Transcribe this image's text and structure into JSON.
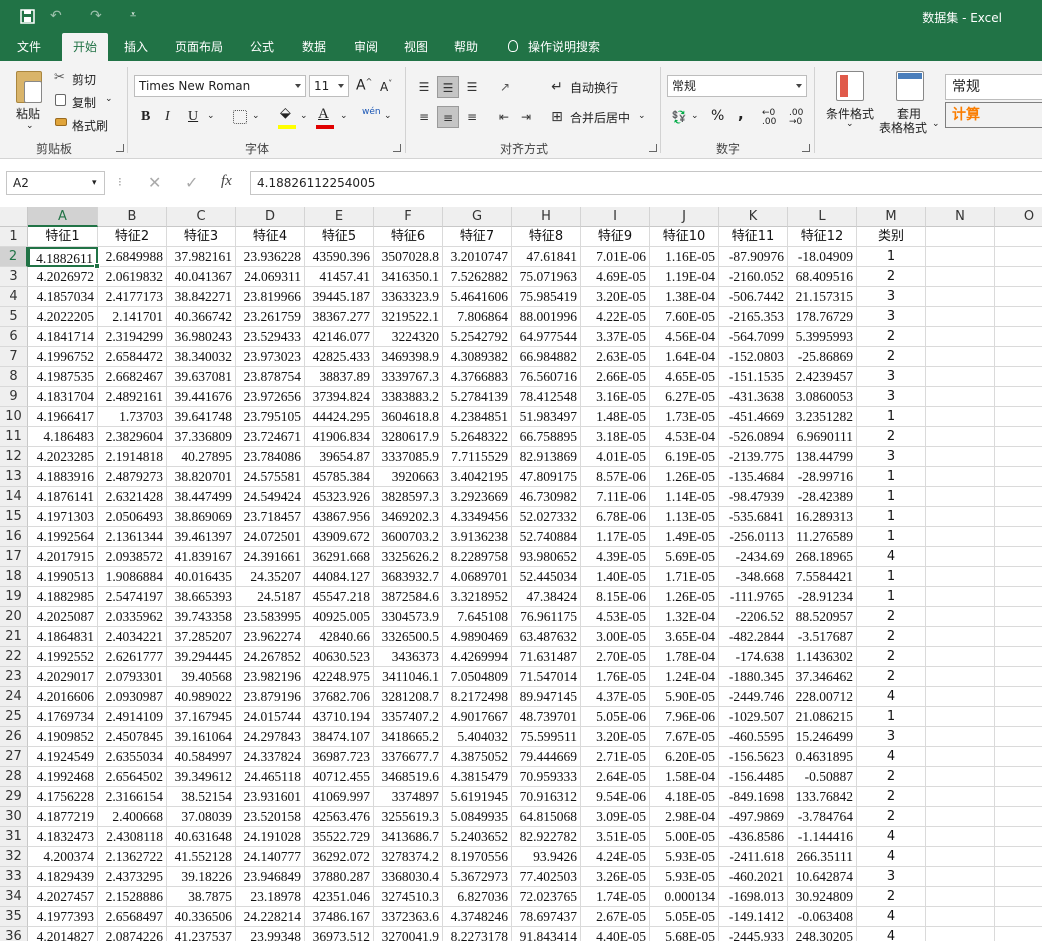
{
  "app": {
    "title": "数据集 - Excel"
  },
  "tabs": [
    "文件",
    "开始",
    "插入",
    "页面布局",
    "公式",
    "数据",
    "审阅",
    "视图",
    "帮助"
  ],
  "active_tab": "开始",
  "tell_me": "操作说明搜索",
  "ribbon": {
    "clipboard": {
      "label": "剪贴板",
      "paste": "粘贴",
      "cut": "剪切",
      "copy": "复制",
      "format_painter": "格式刷"
    },
    "font": {
      "label": "字体",
      "name": "Times New Roman",
      "size": "11",
      "bold": "B",
      "italic": "I",
      "underline": "U",
      "grow": "A",
      "shrink": "A",
      "phonetic": "wén"
    },
    "alignment": {
      "label": "对齐方式",
      "wrap": "自动换行",
      "merge": "合并后居中"
    },
    "number": {
      "label": "数字",
      "format": "常规",
      "percent": "%",
      "comma": ","
    },
    "styles": {
      "conditional": "条件格式",
      "table_line1": "套用",
      "table_line2": "表格格式",
      "normal": "常规",
      "calc": "计算"
    }
  },
  "formula_bar": {
    "name_box": "A2",
    "formula": "4.18826112254005"
  },
  "sheet": {
    "columns": [
      "A",
      "B",
      "C",
      "D",
      "E",
      "F",
      "G",
      "H",
      "I",
      "J",
      "K",
      "L",
      "M",
      "N",
      "O"
    ],
    "headers": [
      "特征1",
      "特征2",
      "特征3",
      "特征4",
      "特征5",
      "特征6",
      "特征7",
      "特征8",
      "特征9",
      "特征10",
      "特征11",
      "特征12",
      "类别"
    ],
    "active_cell": "A2",
    "rows": [
      [
        "4.1882611",
        "2.6849988",
        "37.982161",
        "23.936228",
        "43590.396",
        "3507028.8",
        "3.2010747",
        "47.61841",
        "7.01E-06",
        "1.16E-05",
        "-87.90976",
        "-18.04909",
        "1"
      ],
      [
        "4.2026972",
        "2.0619832",
        "40.041367",
        "24.069311",
        "41457.41",
        "3416350.1",
        "7.5262882",
        "75.071963",
        "4.69E-05",
        "1.19E-04",
        "-2160.052",
        "68.409516",
        "2"
      ],
      [
        "4.1857034",
        "2.4177173",
        "38.842271",
        "23.819966",
        "39445.187",
        "3363323.9",
        "5.4641606",
        "75.985419",
        "3.20E-05",
        "1.38E-04",
        "-506.7442",
        "21.157315",
        "3"
      ],
      [
        "4.2022205",
        "2.141701",
        "40.366742",
        "23.261759",
        "38367.277",
        "3219522.1",
        "7.806864",
        "88.001996",
        "4.22E-05",
        "7.60E-05",
        "-2165.353",
        "178.76729",
        "3"
      ],
      [
        "4.1841714",
        "2.3194299",
        "36.980243",
        "23.529433",
        "42146.077",
        "3224320",
        "5.2542792",
        "64.977544",
        "3.37E-05",
        "4.56E-04",
        "-564.7099",
        "5.3995993",
        "2"
      ],
      [
        "4.1996752",
        "2.6584472",
        "38.340032",
        "23.973023",
        "42825.433",
        "3469398.9",
        "4.3089382",
        "66.984882",
        "2.63E-05",
        "1.64E-04",
        "-152.0803",
        "-25.86869",
        "2"
      ],
      [
        "4.1987535",
        "2.6682467",
        "39.637081",
        "23.878754",
        "38837.89",
        "3339767.3",
        "4.3766883",
        "76.560716",
        "2.66E-05",
        "4.65E-05",
        "-151.1535",
        "2.4239457",
        "3"
      ],
      [
        "4.1831704",
        "2.4892161",
        "39.441676",
        "23.972656",
        "37394.824",
        "3383883.2",
        "5.2784139",
        "78.412548",
        "3.16E-05",
        "6.27E-05",
        "-431.3638",
        "3.0860053",
        "3"
      ],
      [
        "4.1966417",
        "1.73703",
        "39.641748",
        "23.795105",
        "44424.295",
        "3604618.8",
        "4.2384851",
        "51.983497",
        "1.48E-05",
        "1.73E-05",
        "-451.4669",
        "3.2351282",
        "1"
      ],
      [
        "4.186483",
        "2.3829604",
        "37.336809",
        "23.724671",
        "41906.834",
        "3280617.9",
        "5.2648322",
        "66.758895",
        "3.18E-05",
        "4.53E-04",
        "-526.0894",
        "6.9690111",
        "2"
      ],
      [
        "4.2023285",
        "2.1914818",
        "40.27895",
        "23.784086",
        "39654.87",
        "3337085.9",
        "7.7115529",
        "82.913869",
        "4.01E-05",
        "6.19E-05",
        "-2139.775",
        "138.44799",
        "3"
      ],
      [
        "4.1883916",
        "2.4879273",
        "38.820701",
        "24.575581",
        "45785.384",
        "3920663",
        "3.4042195",
        "47.809175",
        "8.57E-06",
        "1.26E-05",
        "-135.4684",
        "-28.99716",
        "1"
      ],
      [
        "4.1876141",
        "2.6321428",
        "38.447499",
        "24.549424",
        "45323.926",
        "3828597.3",
        "3.2923669",
        "46.730982",
        "7.11E-06",
        "1.14E-05",
        "-98.47939",
        "-28.42389",
        "1"
      ],
      [
        "4.1971303",
        "2.0506493",
        "38.869069",
        "23.718457",
        "43867.956",
        "3469202.3",
        "4.3349456",
        "52.027332",
        "6.78E-06",
        "1.13E-05",
        "-535.6841",
        "16.289313",
        "1"
      ],
      [
        "4.1992564",
        "2.1361344",
        "39.461397",
        "24.072501",
        "43909.672",
        "3600703.2",
        "3.9136238",
        "52.740884",
        "1.17E-05",
        "1.49E-05",
        "-256.0113",
        "11.276589",
        "1"
      ],
      [
        "4.2017915",
        "2.0938572",
        "41.839167",
        "24.391661",
        "36291.668",
        "3325626.2",
        "8.2289758",
        "93.980652",
        "4.39E-05",
        "5.69E-05",
        "-2434.69",
        "268.18965",
        "4"
      ],
      [
        "4.1990513",
        "1.9086884",
        "40.016435",
        "24.35207",
        "44084.127",
        "3683932.7",
        "4.0689701",
        "52.445034",
        "1.40E-05",
        "1.71E-05",
        "-348.668",
        "7.5584421",
        "1"
      ],
      [
        "4.1882985",
        "2.5474197",
        "38.665393",
        "24.5187",
        "45547.218",
        "3872584.6",
        "3.3218952",
        "47.38424",
        "8.15E-06",
        "1.26E-05",
        "-111.9765",
        "-28.91234",
        "1"
      ],
      [
        "4.2025087",
        "2.0335962",
        "39.743358",
        "23.583995",
        "40925.005",
        "3304573.9",
        "7.645108",
        "76.961175",
        "4.53E-05",
        "1.32E-04",
        "-2206.52",
        "88.520957",
        "2"
      ],
      [
        "4.1864831",
        "2.4034221",
        "37.285207",
        "23.962274",
        "42840.66",
        "3326500.5",
        "4.9890469",
        "63.487632",
        "3.00E-05",
        "3.65E-04",
        "-482.2844",
        "-3.517687",
        "2"
      ],
      [
        "4.1992552",
        "2.6261777",
        "39.294445",
        "24.267852",
        "40630.523",
        "3436373",
        "4.4269994",
        "71.631487",
        "2.70E-05",
        "1.78E-04",
        "-174.638",
        "1.1436302",
        "2"
      ],
      [
        "4.2029017",
        "2.0793301",
        "39.40568",
        "23.982196",
        "42248.975",
        "3411046.1",
        "7.0504809",
        "71.547014",
        "1.76E-05",
        "1.24E-04",
        "-1880.345",
        "37.346462",
        "2"
      ],
      [
        "4.2016606",
        "2.0930987",
        "40.989022",
        "23.879196",
        "37682.706",
        "3281208.7",
        "8.2172498",
        "89.947145",
        "4.37E-05",
        "5.90E-05",
        "-2449.746",
        "228.00712",
        "4"
      ],
      [
        "4.1769734",
        "2.4914109",
        "37.167945",
        "24.015744",
        "43710.194",
        "3357407.2",
        "4.9017667",
        "48.739701",
        "5.05E-06",
        "7.96E-06",
        "-1029.507",
        "21.086215",
        "1"
      ],
      [
        "4.1909852",
        "2.4507845",
        "39.161064",
        "24.297843",
        "38474.107",
        "3418665.2",
        "5.404032",
        "75.599511",
        "3.20E-05",
        "7.67E-05",
        "-460.5595",
        "15.246499",
        "3"
      ],
      [
        "4.1924549",
        "2.6355034",
        "40.584997",
        "24.337824",
        "36987.723",
        "3376677.7",
        "4.3875052",
        "79.444669",
        "2.71E-05",
        "6.20E-05",
        "-156.5623",
        "0.4631895",
        "4"
      ],
      [
        "4.1992468",
        "2.6564502",
        "39.349612",
        "24.465118",
        "40712.455",
        "3468519.6",
        "4.3815479",
        "70.959333",
        "2.64E-05",
        "1.58E-04",
        "-156.4485",
        "-0.50887",
        "2"
      ],
      [
        "4.1756228",
        "2.3166154",
        "38.52154",
        "23.931601",
        "41069.997",
        "3374897",
        "5.6191945",
        "70.916312",
        "9.54E-06",
        "4.18E-05",
        "-849.1698",
        "133.76842",
        "2"
      ],
      [
        "4.1877219",
        "2.400668",
        "37.08039",
        "23.520158",
        "42563.476",
        "3255619.3",
        "5.0849935",
        "64.815068",
        "3.09E-05",
        "2.98E-04",
        "-497.9869",
        "-3.784764",
        "2"
      ],
      [
        "4.1832473",
        "2.4308118",
        "40.631648",
        "24.191028",
        "35522.729",
        "3413686.7",
        "5.2403652",
        "82.922782",
        "3.51E-05",
        "5.00E-05",
        "-436.8586",
        "-1.144416",
        "4"
      ],
      [
        "4.200374",
        "2.1362722",
        "41.552128",
        "24.140777",
        "36292.072",
        "3278374.2",
        "8.1970556",
        "93.9426",
        "4.24E-05",
        "5.93E-05",
        "-2411.618",
        "266.35111",
        "4"
      ],
      [
        "4.1829439",
        "2.4373295",
        "39.18226",
        "23.946849",
        "37880.287",
        "3368030.4",
        "5.3672973",
        "77.402503",
        "3.26E-05",
        "5.93E-05",
        "-460.2021",
        "10.642874",
        "3"
      ],
      [
        "4.2027457",
        "2.1528886",
        "38.7875",
        "23.18978",
        "42351.046",
        "3274510.3",
        "6.827036",
        "72.023765",
        "1.74E-05",
        "0.000134",
        "-1698.013",
        "30.924809",
        "2"
      ],
      [
        "4.1977393",
        "2.6568497",
        "40.336506",
        "24.228214",
        "37486.167",
        "3372363.6",
        "4.3748246",
        "78.697437",
        "2.67E-05",
        "5.05E-05",
        "-149.1412",
        "-0.063408",
        "4"
      ],
      [
        "4.2014827",
        "2.0874226",
        "41.237537",
        "23.99348",
        "36973.512",
        "3270041.9",
        "8.2273178",
        "91.843414",
        "4.40E-05",
        "5.68E-05",
        "-2445.933",
        "248.30205",
        "4"
      ]
    ]
  }
}
